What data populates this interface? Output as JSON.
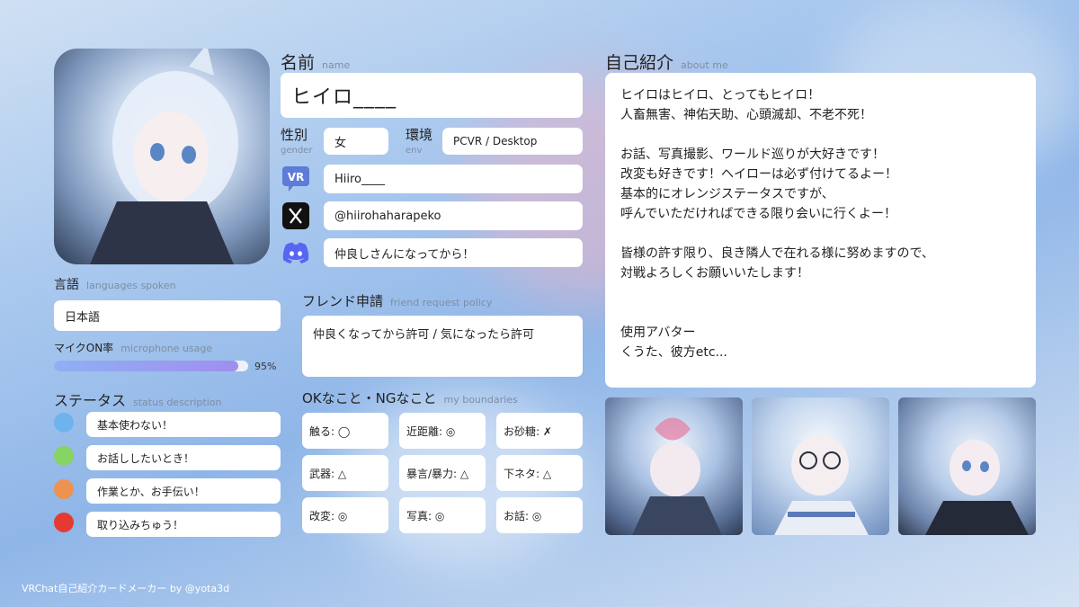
{
  "profile": {
    "name_label": "名前",
    "name_label_en": "name",
    "name_value": "ヒイロ____",
    "gender_label": "性別",
    "gender_label_en": "gender",
    "gender_value": "女",
    "env_label": "環境",
    "env_label_en": "env",
    "env_value": "PCVR / Desktop",
    "vrchat_value": "Hiiro____",
    "x_value": "@hiirohaharapeko",
    "discord_value": "仲良しさんになってから！"
  },
  "languages": {
    "label": "言語",
    "label_en": "languages spoken",
    "value": "日本語"
  },
  "mic": {
    "label": "マイクON率",
    "label_en": "microphone usage",
    "percent": 95,
    "percent_text": "95%"
  },
  "status": {
    "label": "ステータス",
    "label_en": "status description",
    "items": [
      {
        "color": "#6fb3ee",
        "text": "基本使わない！"
      },
      {
        "color": "#86d464",
        "text": "お話ししたいとき！"
      },
      {
        "color": "#ef9150",
        "text": "作業とか、お手伝い！"
      },
      {
        "color": "#e53a31",
        "text": "取り込みちゅう！"
      }
    ]
  },
  "friend_request": {
    "label": "フレンド申請",
    "label_en": "friend request policy",
    "value": "仲良くなってから許可 / 気になったら許可"
  },
  "boundaries": {
    "label": "OKなこと・NGなこと",
    "label_en": "my boundaries",
    "items": [
      "触る: ◯",
      "近距離: ◎",
      "お砂糖: ✗",
      "武器: △",
      "暴言/暴力: △",
      "下ネタ: △",
      "改変: ◎",
      "写真: ◎",
      "お話: ◎"
    ]
  },
  "about": {
    "label": "自己紹介",
    "label_en": "about me",
    "lines": [
      "ヒイロはヒイロ、とってもヒイロ！",
      "人畜無害、神佑天助、心頭滅却、不老不死！",
      "",
      "お話、写真撮影、ワールド巡りが大好きです！",
      "改変も好きです！ヘイローは必ず付けてるよー！",
      "基本的にオレンジステータスですが、",
      "呼んでいただければできる限り会いに行くよー！",
      "",
      "皆様の許す限り、良き隣人で在れる様に努めますので、",
      "対戦よろしくお願いいたします！",
      "",
      "",
      "使用アバター",
      "くうた、彼方etc..."
    ]
  },
  "icons": {
    "vrchat": "vrchat-icon",
    "x": "x-logo-icon",
    "discord": "discord-icon"
  },
  "footer": {
    "credit": "VRChat自己紹介カードメーカー by @yota3d"
  }
}
